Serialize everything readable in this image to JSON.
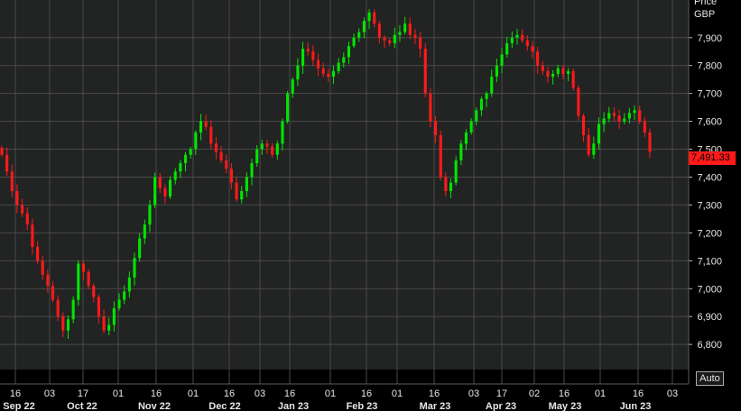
{
  "price_header": {
    "title": "Price",
    "currency": "GBP"
  },
  "last_price_label": "7,491.33",
  "auto_label": "Auto",
  "colors": {
    "up": "#00e600",
    "down": "#ff1a1a",
    "grid": "#4a4a4a",
    "background": "#222323",
    "last_badge": "#ff1a1a"
  },
  "chart_data": {
    "type": "candlestick",
    "title": "",
    "ylabel": "Price GBP",
    "ylim": [
      6710,
      8035
    ],
    "y_ticks": [
      "6,800",
      "6,900",
      "7,000",
      "7,100",
      "7,200",
      "7,300",
      "7,400",
      "7,500",
      "7,600",
      "7,700",
      "7,800",
      "7,900"
    ],
    "x_ticks": [
      "16",
      "03",
      "17",
      "01",
      "16",
      "01",
      "16",
      "03",
      "16",
      "01",
      "16",
      "01",
      "16",
      "03",
      "17",
      "02",
      "16",
      "01",
      "16",
      "03"
    ],
    "month_labels": [
      "Sep 22",
      "Oct 22",
      "Nov 22",
      "Dec 22",
      "Jan 23",
      "Feb 23",
      "Mar 23",
      "Apr 23",
      "May 23",
      "Jun 23"
    ],
    "last_value": 7491.33,
    "closes": [
      7480,
      7420,
      7350,
      7300,
      7270,
      7230,
      7150,
      7100,
      7050,
      7010,
      6960,
      6900,
      6850,
      6890,
      6960,
      7090,
      7060,
      7010,
      6970,
      6900,
      6850,
      6870,
      6930,
      6960,
      6990,
      7040,
      7110,
      7180,
      7230,
      7300,
      7400,
      7360,
      7330,
      7390,
      7420,
      7450,
      7480,
      7500,
      7560,
      7600,
      7580,
      7520,
      7490,
      7460,
      7430,
      7380,
      7320,
      7350,
      7400,
      7450,
      7500,
      7520,
      7510,
      7480,
      7520,
      7600,
      7700,
      7750,
      7800,
      7860,
      7850,
      7820,
      7790,
      7770,
      7760,
      7780,
      7810,
      7830,
      7870,
      7900,
      7920,
      7960,
      7990,
      7950,
      7900,
      7890,
      7880,
      7910,
      7920,
      7950,
      7910,
      7900,
      7860,
      7700,
      7600,
      7550,
      7400,
      7350,
      7380,
      7460,
      7520,
      7560,
      7600,
      7640,
      7680,
      7700,
      7760,
      7800,
      7840,
      7880,
      7900,
      7910,
      7890,
      7870,
      7850,
      7800,
      7780,
      7760,
      7770,
      7790,
      7770,
      7780,
      7720,
      7620,
      7550,
      7480,
      7520,
      7590,
      7610,
      7630,
      7620,
      7600,
      7610,
      7630,
      7640,
      7600,
      7560,
      7491.33
    ]
  }
}
